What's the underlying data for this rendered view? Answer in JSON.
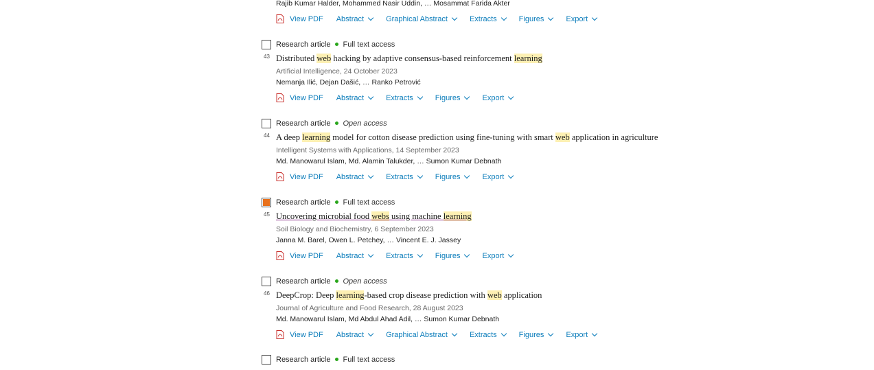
{
  "top_partial": {
    "authors": "Rajib Kumar Halder, Mohammed Nasir Uddin, … Mosammat Farida Akter",
    "actions": [
      "View PDF",
      "Abstract",
      "Graphical Abstract",
      "Extracts",
      "Figures",
      "Export"
    ]
  },
  "results": [
    {
      "number": "43",
      "type": "Research article",
      "access": "Full text access",
      "title_parts": [
        "Distributed ",
        "web",
        " hacking by adaptive consensus-based reinforcement ",
        "learning",
        ""
      ],
      "journal": "Artificial Intelligence, 24 October 2023",
      "authors": "Nemanja Ilić, Dejan Dašić, … Ranko Petrović",
      "actions": [
        "View PDF",
        "Abstract",
        "Extracts",
        "Figures",
        "Export"
      ]
    },
    {
      "number": "44",
      "type": "Research article",
      "access": "Open access",
      "title_parts": [
        "A deep ",
        "learning",
        " model for cotton disease prediction using fine-tuning with smart ",
        "web",
        " application in agriculture"
      ],
      "journal": "Intelligent Systems with Applications, 14 September 2023",
      "authors": "Md. Manowarul Islam, Md. Alamin Talukder, … Sumon Kumar Debnath",
      "actions": [
        "View PDF",
        "Abstract",
        "Extracts",
        "Figures",
        "Export"
      ]
    },
    {
      "number": "45",
      "type": "Research article",
      "access": "Full text access",
      "title_parts": [
        "Uncovering microbial food ",
        "webs",
        " using machine ",
        "learning",
        ""
      ],
      "journal": "Soil Biology and Biochemistry, 6 September 2023",
      "authors": "Janna M. Barel, Owen L. Petchey, … Vincent E. J. Jassey",
      "actions": [
        "View PDF",
        "Abstract",
        "Extracts",
        "Figures",
        "Export"
      ]
    },
    {
      "number": "46",
      "type": "Research article",
      "access": "Open access",
      "title_parts": [
        "DeepCrop: Deep ",
        "learning",
        "-based crop disease prediction with ",
        "web",
        " application"
      ],
      "journal": "Journal of Agriculture and Food Research, 28 August 2023",
      "authors": "Md. Manowarul Islam, Md Abdul Ahad Adil, … Sumon Kumar Debnath",
      "actions": [
        "View PDF",
        "Abstract",
        "Graphical Abstract",
        "Extracts",
        "Figures",
        "Export"
      ]
    },
    {
      "type": "Research article",
      "access": "Full text access"
    }
  ],
  "colors": {
    "link": "#0c7dbb",
    "highlight": "#fdf0b3",
    "access_dot": "#29a61b",
    "checked": "#e9711c"
  },
  "icons": {
    "pdf": "pdf-icon",
    "chevron": "chevron-down-icon"
  }
}
